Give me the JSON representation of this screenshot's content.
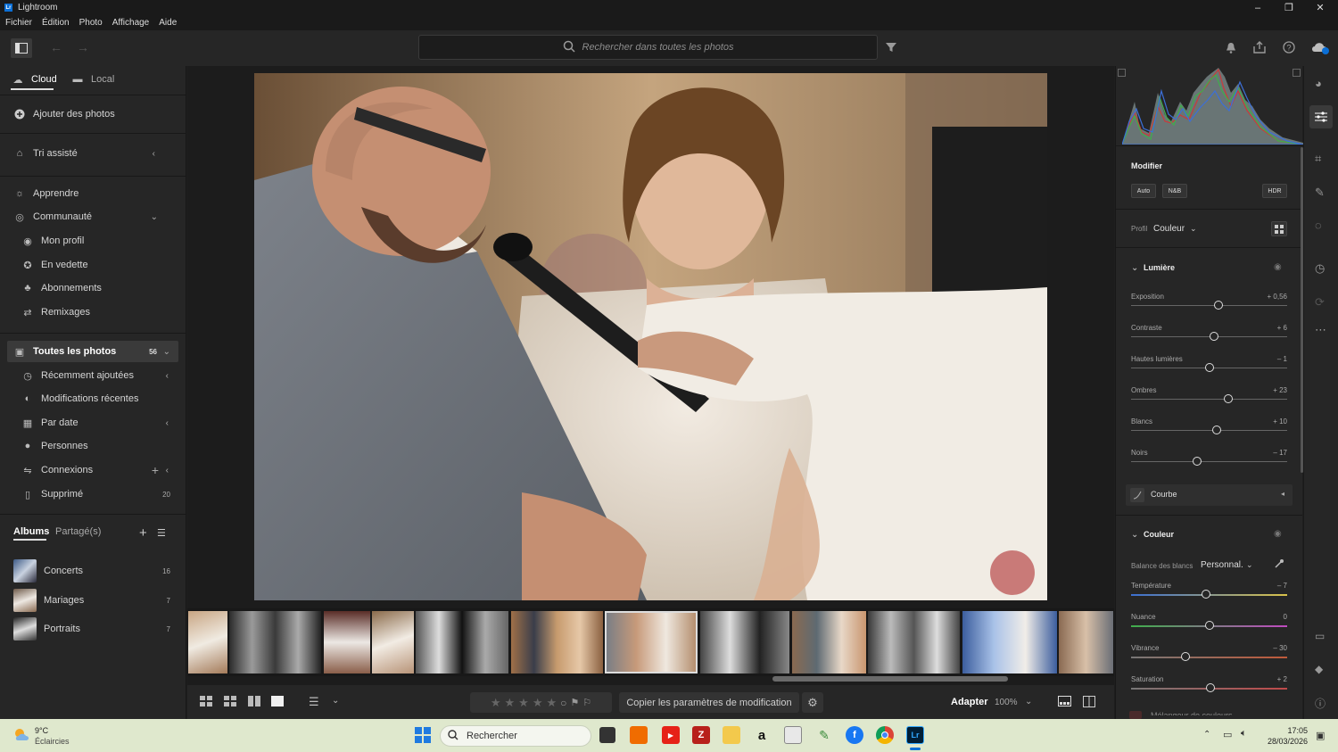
{
  "app": {
    "title": "Lightroom",
    "logo": "Lr"
  },
  "window": {
    "minimize": "–",
    "maximize": "❐",
    "close": "✕"
  },
  "menu": [
    "Fichier",
    "Édition",
    "Photo",
    "Affichage",
    "Aide"
  ],
  "search": {
    "placeholder": "Rechercher dans toutes les photos"
  },
  "left": {
    "tabs": {
      "cloud": "Cloud",
      "local": "Local"
    },
    "add_photos": "Ajouter des photos",
    "assisted_sort": "Tri assisté",
    "learn": "Apprendre",
    "community": {
      "label": "Communauté",
      "items": [
        "Mon profil",
        "En vedette",
        "Abonnements",
        "Remixages"
      ]
    },
    "all_photos": {
      "label": "Toutes les photos",
      "count": "56"
    },
    "library": [
      "Récemment ajoutées",
      "Modifications récentes",
      "Par date",
      "Personnes",
      "Connexions",
      "Supprimé"
    ],
    "deleted_count": "20",
    "albums_tab": "Albums",
    "shared_tab": "Partagé(s)",
    "albums": [
      {
        "name": "Concerts",
        "count": "16"
      },
      {
        "name": "Mariages",
        "count": "7"
      },
      {
        "name": "Portraits",
        "count": "7"
      }
    ]
  },
  "bottom": {
    "copy_settings": "Copier les paramètres de modification",
    "fit": "Adapter",
    "zoom": "100%"
  },
  "right": {
    "edit_title": "Modifier",
    "auto": "Auto",
    "bw": "N&B",
    "hdr": "HDR",
    "profile_label": "Profil",
    "profile_value": "Couleur",
    "light_section": "Lumière",
    "light_sliders": [
      {
        "label": "Exposition",
        "value": "+ 0,56",
        "fraction": 0.56
      },
      {
        "label": "Contraste",
        "value": "+ 6",
        "fraction": 0.53
      },
      {
        "label": "Hautes lumières",
        "value": "– 1",
        "fraction": 0.5
      },
      {
        "label": "Ombres",
        "value": "+ 23",
        "fraction": 0.62
      },
      {
        "label": "Blancs",
        "value": "+ 10",
        "fraction": 0.55
      },
      {
        "label": "Noirs",
        "value": "– 17",
        "fraction": 0.42
      }
    ],
    "curve": "Courbe",
    "color_section": "Couleur",
    "wb_label": "Balance des blancs",
    "wb_value": "Personnal.",
    "color_sliders": [
      {
        "label": "Température",
        "value": "– 7",
        "fraction": 0.48
      },
      {
        "label": "Nuance",
        "value": "0",
        "fraction": 0.5
      },
      {
        "label": "Vibrance",
        "value": "– 30",
        "fraction": 0.35
      },
      {
        "label": "Saturation",
        "value": "+ 2",
        "fraction": 0.51
      }
    ],
    "cutoff_label": "Mélangeur de couleurs"
  },
  "taskbar": {
    "weather_temp": "9°C",
    "weather_desc": "Éclaircies",
    "search_label": "Rechercher",
    "time": "17:05",
    "date": "28/03/2026"
  },
  "colors": {
    "accent": "#0b6fd6",
    "panel": "#262626",
    "taskbar": "#dfe8cd"
  }
}
